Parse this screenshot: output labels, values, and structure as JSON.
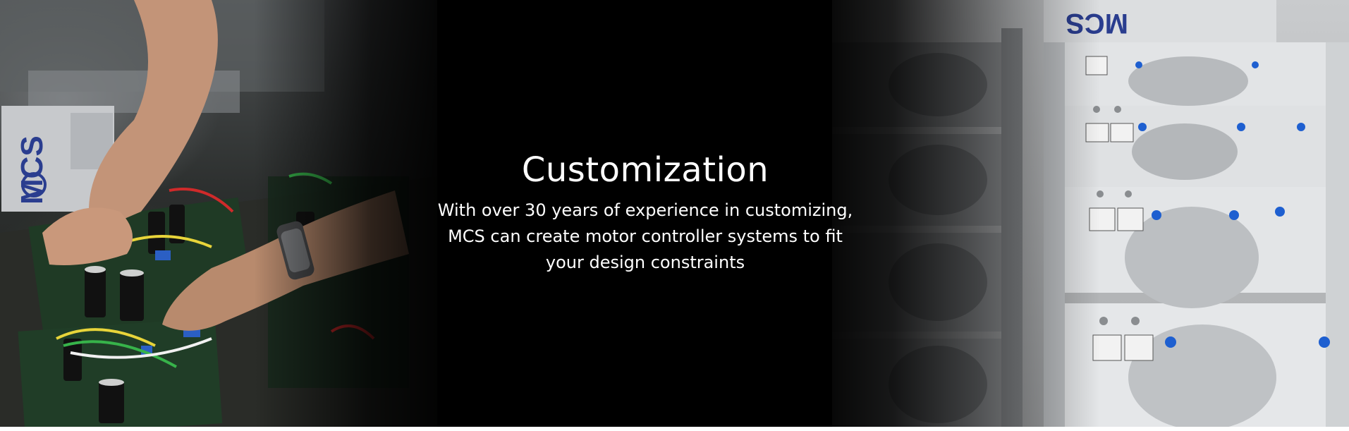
{
  "banner": {
    "title": "Customization",
    "description": "With over 30 years of experience in customizing, MCS can create motor controller systems to fit your design constraints",
    "logo_text": "MCS"
  },
  "colors": {
    "background": "#000000",
    "text": "#ffffff",
    "board_green": "#2f5a38",
    "enclosure_white": "#d8dadc",
    "screw_blue": "#1e5fd0"
  }
}
